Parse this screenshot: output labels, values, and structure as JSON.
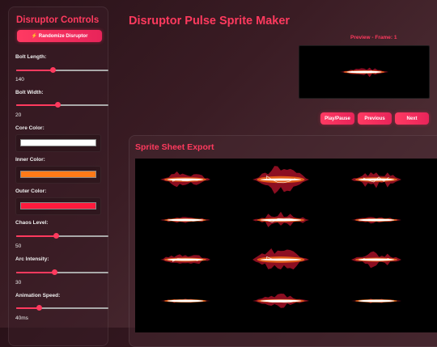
{
  "sidebar": {
    "title": "Disruptor Controls",
    "randomize_icon": "lightning-icon",
    "randomize_label": "⚡ Randomize Disruptor",
    "bolt_length": {
      "label": "Bolt Length:",
      "value": "140",
      "fraction": 0.4
    },
    "bolt_width": {
      "label": "Bolt Width:",
      "value": "20",
      "fraction": 0.45
    },
    "core_color": {
      "label": "Core Color:",
      "hex": "#ffffff"
    },
    "inner_color": {
      "label": "Inner Color:",
      "hex": "#ff7a18"
    },
    "outer_color": {
      "label": "Outer Color:",
      "hex": "#ff1a3c"
    },
    "chaos_level": {
      "label": "Chaos Level:",
      "value": "50",
      "fraction": 0.43
    },
    "arc_intensity": {
      "label": "Arc Intensity:",
      "value": "30",
      "fraction": 0.42
    },
    "animation_speed": {
      "label": "Animation Speed:",
      "value": "40ms",
      "fraction": 0.25
    }
  },
  "main": {
    "title": "Disruptor Pulse Sprite Maker",
    "preview_label": "Preview - Frame: 1",
    "buttons": {
      "play_pause": "Play/Pause",
      "previous": "Previous",
      "next": "Next"
    },
    "sheet_title": "Sprite Sheet Export"
  },
  "colors": {
    "accent": "#ff3a5e",
    "core": "#ffffff",
    "inner": "#ff7a18",
    "outer": "#ff1a3c"
  }
}
